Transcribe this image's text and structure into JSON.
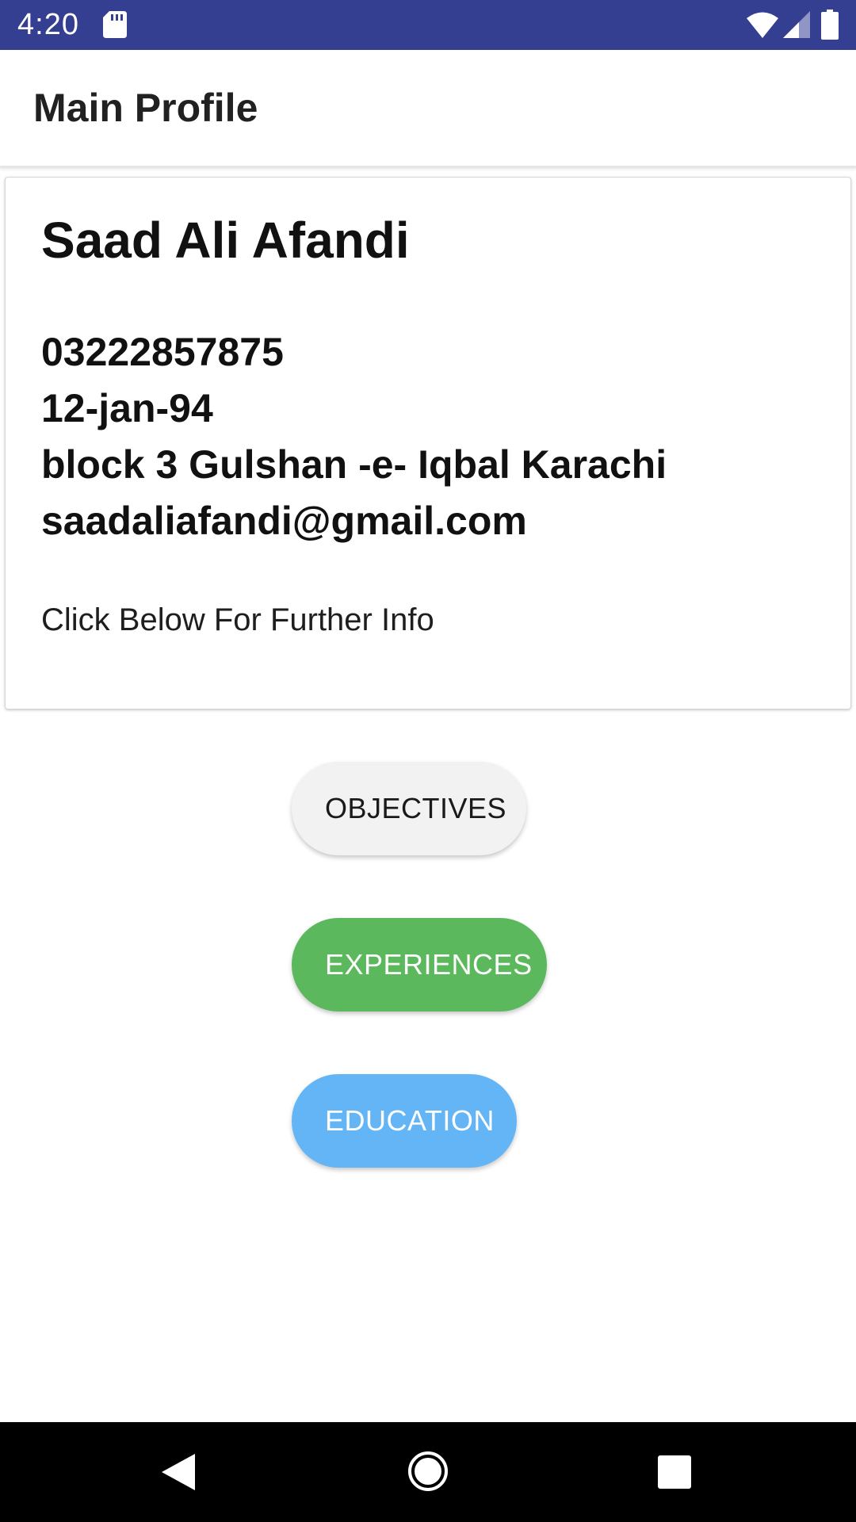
{
  "status_bar": {
    "time": "4:20",
    "background_color": "#353f91"
  },
  "app_bar": {
    "title": "Main Profile"
  },
  "profile": {
    "name": "Saad Ali Afandi",
    "phone": "03222857875",
    "date_of_birth": "12-jan-94",
    "address": "block 3 Gulshan -e- Iqbal Karachi",
    "email": "saadaliafandi@gmail.com",
    "hint": "Click Below For Further Info"
  },
  "buttons": {
    "objectives": {
      "label": "OBJECTIVES",
      "color": "#f2f2f2"
    },
    "experiences": {
      "label": "EXPERIENCES",
      "color": "#5cb85c"
    },
    "education": {
      "label": "EDUCATION",
      "color": "#64b5f6"
    }
  },
  "nav_bar": {
    "icons": [
      "back-icon",
      "home-icon",
      "recents-icon"
    ]
  }
}
